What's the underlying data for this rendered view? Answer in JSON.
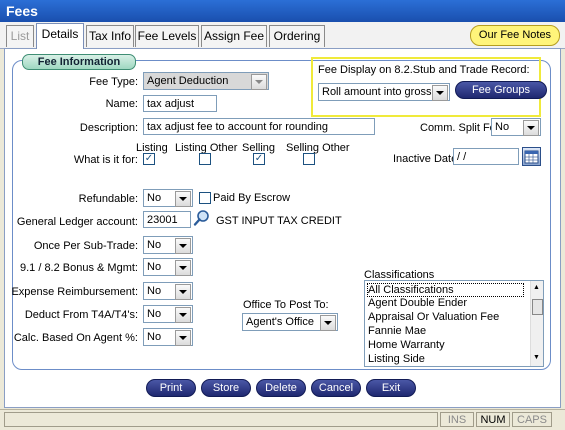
{
  "window": {
    "title": "Fees"
  },
  "tabs": [
    {
      "label": "List",
      "state": "disabled"
    },
    {
      "label": "Details",
      "state": "active"
    },
    {
      "label": "Tax Info",
      "state": "normal"
    },
    {
      "label": "Fee Levels",
      "state": "normal"
    },
    {
      "label": "Assign Fee",
      "state": "normal"
    },
    {
      "label": "Ordering",
      "state": "normal"
    }
  ],
  "fee_notes_button": "Our Fee Notes",
  "section_title": "Fee Information",
  "form": {
    "fee_type_label": "Fee Type:",
    "fee_type_value": "Agent Deduction",
    "name_label": "Name:",
    "name_value": "tax adjust",
    "description_label": "Description:",
    "description_value": "tax adjust fee to account for rounding",
    "comm_split_label": "Comm. Split Fee:",
    "comm_split_value": "No",
    "what_is_it_for_label": "What is it for:",
    "checks": [
      {
        "label": "Listing",
        "checked": true
      },
      {
        "label": "Listing Other",
        "checked": false
      },
      {
        "label": "Selling",
        "checked": true
      },
      {
        "label": "Selling Other",
        "checked": false
      }
    ],
    "inactive_date_label": "Inactive Date:",
    "inactive_date_value": "/ /",
    "refundable_label": "Refundable:",
    "refundable_value": "No",
    "paid_by_escrow_label": "Paid By Escrow",
    "paid_by_escrow_checked": false,
    "gl_label": "General Ledger account:",
    "gl_value": "23001",
    "gl_desc": "GST INPUT TAX CREDIT",
    "once_per_label": "Once Per Sub-Trade:",
    "once_per_value": "No",
    "bonus_label": "9.1 / 8.2 Bonus & Mgmt:",
    "bonus_value": "No",
    "expense_label": "Expense Reimbursement:",
    "expense_value": "No",
    "t4a_label": "Deduct From T4A/T4's:",
    "t4a_value": "No",
    "calc_label": "Calc. Based On Agent %:",
    "calc_value": "No",
    "office_label": "Office To Post To:",
    "office_value": "Agent's Office"
  },
  "fee_display": {
    "label": "Fee Display on 8.2.Stub and Trade Record:",
    "value": "Roll amount into gross",
    "groups_button": "Fee Groups",
    "highlight_color": "#f0ea3a"
  },
  "classifications": {
    "label": "Classifications",
    "items": [
      "All Classifications",
      "Agent Double Ender",
      "Appraisal Or Valuation Fee",
      "Fannie Mae",
      "Home Warranty",
      "Listing Side"
    ]
  },
  "buttons": [
    "Print",
    "Store",
    "Delete",
    "Cancel",
    "Exit"
  ],
  "status_bar": [
    "INS",
    "NUM",
    "CAPS"
  ],
  "icons": [
    "magnifier-icon",
    "calendar-icon",
    "dropdown-arrow-icon"
  ]
}
